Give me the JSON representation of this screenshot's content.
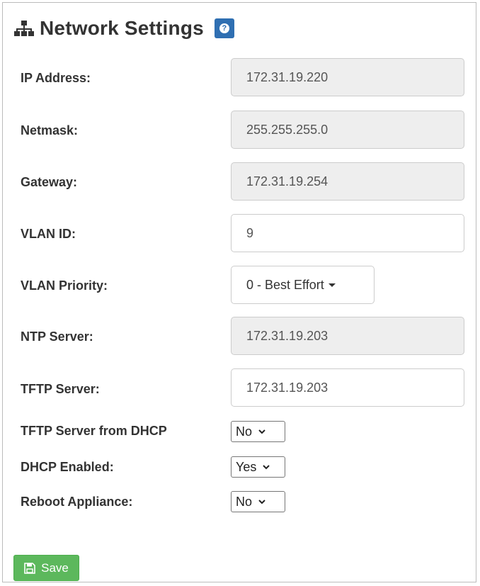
{
  "header": {
    "title": "Network Settings",
    "icon": "sitemap-icon",
    "help_icon": "question-circle-icon",
    "help_badge_color": "#2f6fb2",
    "help_glyph": "?"
  },
  "fields": {
    "ip_address": {
      "label": "IP Address:",
      "value": "172.31.19.220"
    },
    "netmask": {
      "label": "Netmask:",
      "value": "255.255.255.0"
    },
    "gateway": {
      "label": "Gateway:",
      "value": "172.31.19.254"
    },
    "vlan_id": {
      "label": "VLAN ID:",
      "value": "9"
    },
    "vlan_priority": {
      "label": "VLAN Priority:",
      "value": "0 - Best Effort"
    },
    "ntp_server": {
      "label": "NTP Server:",
      "value": "172.31.19.203"
    },
    "tftp_server": {
      "label": "TFTP Server:",
      "value": "172.31.19.203"
    },
    "tftp_from_dhcp": {
      "label": "TFTP Server from DHCP",
      "value": "No"
    },
    "dhcp_enabled": {
      "label": "DHCP Enabled:",
      "value": "Yes"
    },
    "reboot_appliance": {
      "label": "Reboot Appliance:",
      "value": "No"
    }
  },
  "save": {
    "label": "Save",
    "icon": "floppy-disk-icon",
    "color": "#5cb85c"
  },
  "colors": {
    "readonly_bg": "#eeeeee",
    "border": "#cccccc",
    "text": "#333333"
  }
}
